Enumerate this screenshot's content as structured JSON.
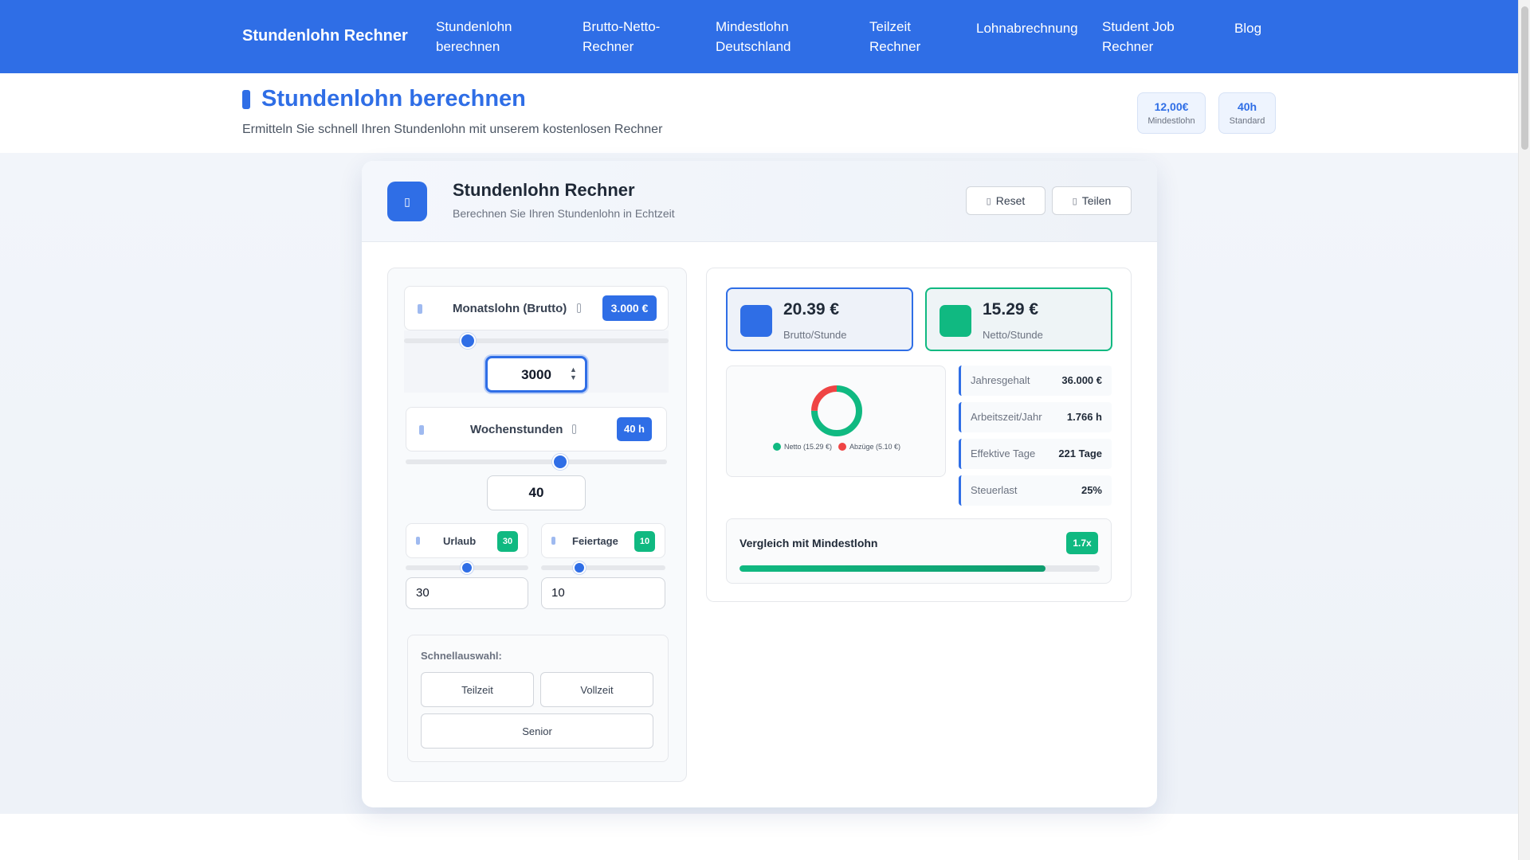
{
  "nav": {
    "brand": "Stundenlohn Rechner",
    "items": [
      {
        "label": "Stundenlohn\nberechnen"
      },
      {
        "label": "Brutto-Netto-\nRechner"
      },
      {
        "label": "Mindestlohn\nDeutschland"
      },
      {
        "label": "Teilzeit\nRechner"
      },
      {
        "label": "Lohnabrechnung"
      },
      {
        "label": "Student Job\nRechner"
      },
      {
        "label": "Blog"
      }
    ]
  },
  "hero": {
    "title": "Stundenlohn berechnen",
    "subtitle": "Ermitteln Sie schnell Ihren Stundenlohn mit unserem kostenlosen Rechner",
    "pills": [
      {
        "value": "12,00€",
        "label": "Mindestlohn"
      },
      {
        "value": "40h",
        "label": "Standard"
      }
    ]
  },
  "card": {
    "title": "Stundenlohn Rechner",
    "subtitle": "Berechnen Sie Ihren Stundenlohn in Echtzeit",
    "reset_label": "Reset",
    "share_label": "Teilen"
  },
  "inputs": {
    "monthly": {
      "label": "Monatslohn (Brutto)",
      "badge": "3.000 €",
      "value": "3000",
      "slider_fraction": 0.24
    },
    "weekly": {
      "label": "Wochenstunden",
      "badge": "40 h",
      "value": "40",
      "slider_fraction": 0.59
    },
    "vacation": {
      "label": "Urlaub",
      "badge": "30",
      "value": "30",
      "slider_fraction": 0.5
    },
    "holidays": {
      "label": "Feiertage",
      "badge": "10",
      "value": "10",
      "slider_fraction": 0.31
    }
  },
  "quick": {
    "title": "Schnellauswahl:",
    "options": [
      "Teilzeit",
      "Vollzeit",
      "Senior"
    ]
  },
  "results": {
    "gross": {
      "value": "20.39 €",
      "label": "Brutto/Stunde"
    },
    "net": {
      "value": "15.29 €",
      "label": "Netto/Stunde"
    },
    "donut": {
      "net_legend": "Netto (15.29 €)",
      "deductions_legend": "Abzüge (5.10 €)",
      "net_value": 15.29,
      "deductions_value": 5.1,
      "net_color": "#10b981",
      "deductions_color": "#ef4444"
    },
    "stats": [
      {
        "label": "Jahresgehalt",
        "value": "36.000 €"
      },
      {
        "label": "Arbeitszeit/Jahr",
        "value": "1.766 h"
      },
      {
        "label": "Effektive Tage",
        "value": "221 Tage"
      },
      {
        "label": "Steuerlast",
        "value": "25%"
      }
    ],
    "comparison": {
      "title": "Vergleich mit Mindestlohn",
      "badge": "1.7x",
      "fill_fraction": 0.85
    }
  },
  "colors": {
    "primary": "#2f6ee6",
    "success": "#10b981",
    "danger": "#ef4444"
  }
}
